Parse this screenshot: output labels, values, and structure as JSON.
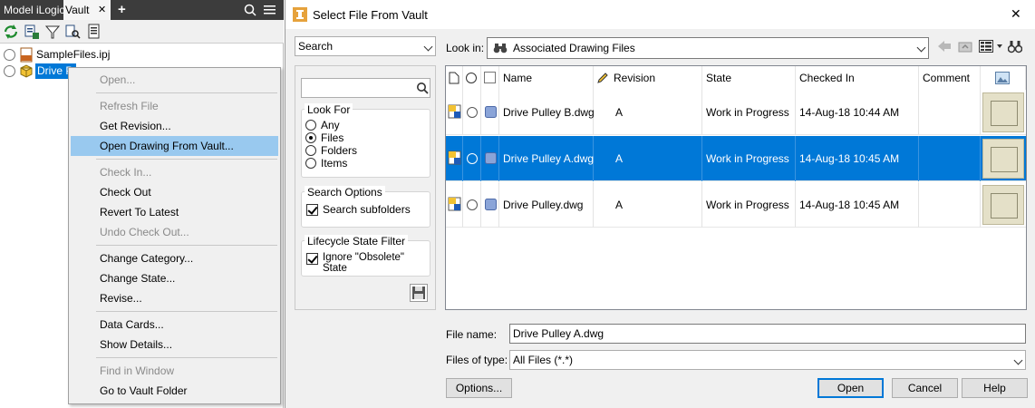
{
  "browser": {
    "tabs": [
      "Model",
      "iLogic",
      "Vault"
    ],
    "active_tab": "Vault",
    "close_glyph": "✕",
    "add_glyph": "+",
    "tree": [
      {
        "label": "SampleFiles.ipj",
        "icon": "project-file-icon"
      },
      {
        "label": "Drive P",
        "icon": "part-file-icon",
        "selected": true
      }
    ]
  },
  "context_menu": {
    "items": [
      {
        "label": "Open...",
        "disabled": true
      },
      {
        "sep": true
      },
      {
        "label": "Refresh File",
        "disabled": true
      },
      {
        "label": "Get Revision...",
        "disabled": false
      },
      {
        "label": "Open Drawing From Vault...",
        "disabled": false,
        "highlighted": true
      },
      {
        "sep": true
      },
      {
        "label": "Check In...",
        "disabled": true
      },
      {
        "label": "Check Out",
        "disabled": false
      },
      {
        "label": "Revert To Latest",
        "disabled": false
      },
      {
        "label": "Undo Check Out...",
        "disabled": true
      },
      {
        "sep": true
      },
      {
        "label": "Change Category...",
        "disabled": false
      },
      {
        "label": "Change State...",
        "disabled": false
      },
      {
        "label": "Revise...",
        "disabled": false
      },
      {
        "sep": true
      },
      {
        "label": "Data Cards...",
        "disabled": false
      },
      {
        "label": "Show Details...",
        "disabled": false
      },
      {
        "sep": true
      },
      {
        "label": "Find in Window",
        "disabled": true
      },
      {
        "label": "Go to Vault Folder",
        "disabled": false
      }
    ]
  },
  "dialog": {
    "title": "Select File From Vault",
    "close_glyph": "✕",
    "mode_select": "Search",
    "look_in_label": "Look in:",
    "look_in_value": "Associated Drawing Files",
    "look_for": {
      "title": "Look For",
      "options": [
        "Any",
        "Files",
        "Folders",
        "Items"
      ],
      "selected": "Files"
    },
    "search_options": {
      "title": "Search Options",
      "checkbox": "Search subfolders",
      "checked": true
    },
    "lifecycle_filter": {
      "title": "Lifecycle State Filter",
      "checkbox": "Ignore \"Obsolete\" State",
      "checked": true
    },
    "columns": [
      "Name",
      "Revision",
      "State",
      "Checked In",
      "Comment"
    ],
    "rows": [
      {
        "name": "Drive Pulley B.dwg",
        "revision": "A",
        "state": "Work in Progress",
        "checked_in": "14-Aug-18 10:44 AM",
        "comment": "",
        "selected": false
      },
      {
        "name": "Drive Pulley A.dwg",
        "revision": "A",
        "state": "Work in Progress",
        "checked_in": "14-Aug-18 10:45 AM",
        "comment": "",
        "selected": true
      },
      {
        "name": "Drive Pulley.dwg",
        "revision": "A",
        "state": "Work in Progress",
        "checked_in": "14-Aug-18 10:45 AM",
        "comment": "",
        "selected": false
      }
    ],
    "file_name_label": "File name:",
    "file_name_value": "Drive Pulley A.dwg",
    "files_of_type_label": "Files of type:",
    "files_of_type_value": "All Files (*.*)",
    "buttons": {
      "options": "Options...",
      "open": "Open",
      "cancel": "Cancel",
      "help": "Help"
    },
    "colors": {
      "selection": "#0078d7",
      "menu_highlight": "#99c9ef"
    }
  }
}
